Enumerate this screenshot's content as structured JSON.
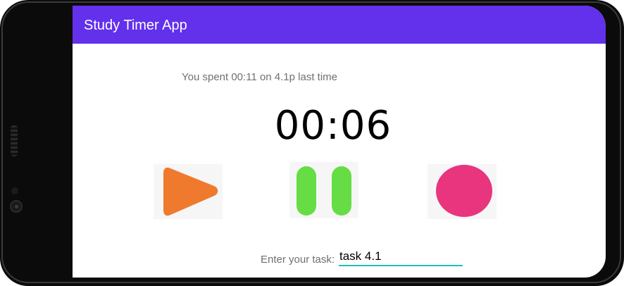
{
  "app": {
    "title": "Study Timer App",
    "accent_color": "#6330ec"
  },
  "summary": {
    "last_time_text": "You spent 00:11 on 4.1p last time"
  },
  "timer": {
    "display": "00:06"
  },
  "controls": {
    "play": {
      "icon": "play-icon",
      "color": "#ef7a2e"
    },
    "pause": {
      "icon": "pause-icon",
      "color": "#66dd44"
    },
    "stop": {
      "icon": "stop-icon",
      "color": "#e8357d"
    }
  },
  "task": {
    "label": "Enter your task:",
    "value": "task 4.1",
    "underline_color": "#1ec2b5"
  }
}
